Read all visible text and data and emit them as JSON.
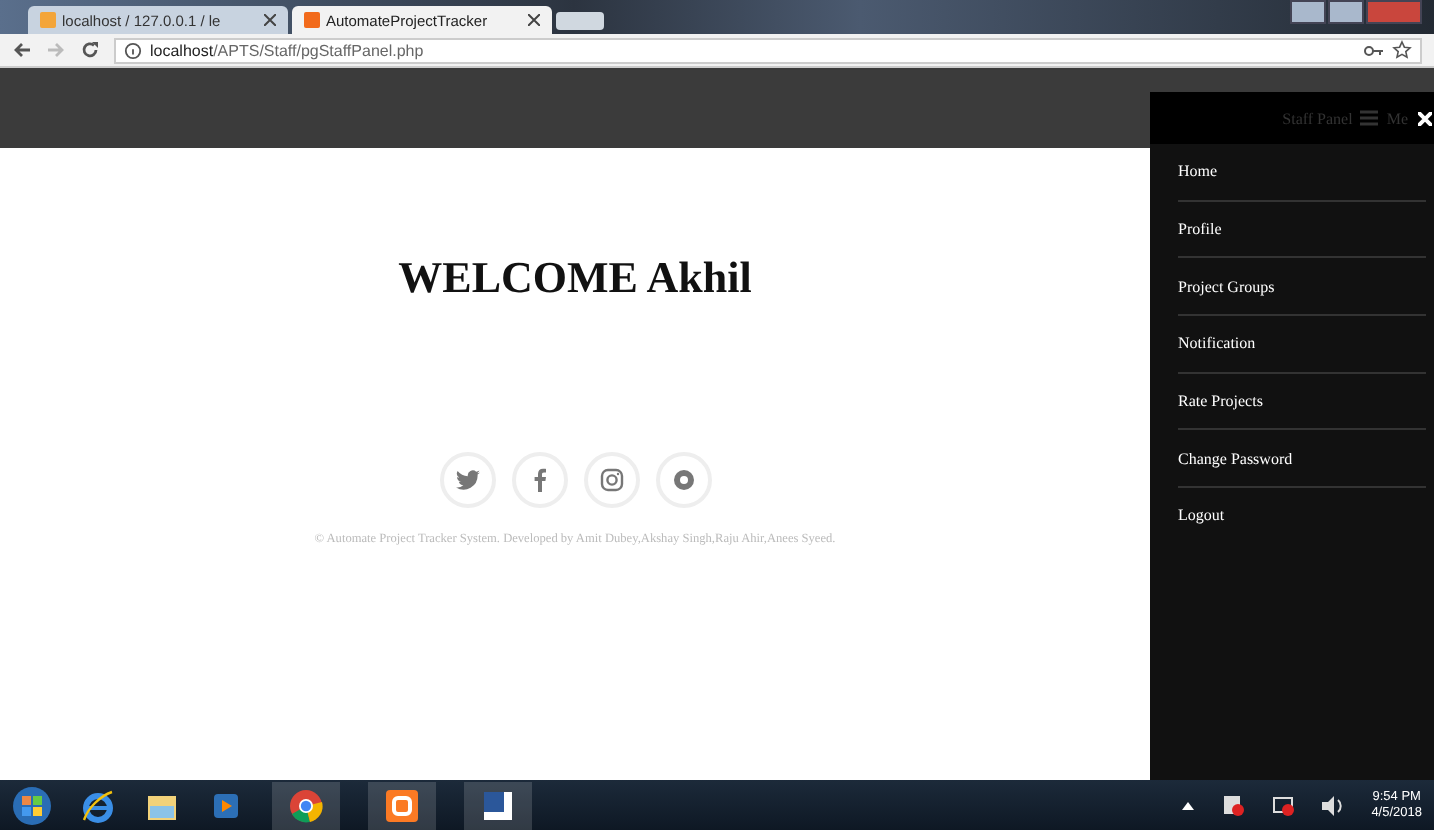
{
  "browser": {
    "tabs": [
      {
        "title": "localhost / 127.0.0.1 / le",
        "selected": false
      },
      {
        "title": "AutomateProjectTracker",
        "selected": true
      }
    ],
    "url_host": "localhost",
    "url_path": "/APTS/Staff/pgStaffPanel.php"
  },
  "sidebar": {
    "title": "Staff Panel",
    "menu_label": "Me",
    "items": [
      {
        "label": "Home"
      },
      {
        "label": "Profile"
      },
      {
        "label": "Project Groups"
      },
      {
        "label": "Notification"
      },
      {
        "label": "Rate Projects"
      },
      {
        "label": "Change Password"
      },
      {
        "label": "Logout"
      }
    ]
  },
  "main": {
    "welcome": "WELCOME Akhil",
    "footer": "© Automate Project Tracker System. Developed by Amit Dubey,Akshay Singh,Raju Ahir,Anees Syeed."
  },
  "taskbar": {
    "time": "9:54 PM",
    "date": "4/5/2018"
  }
}
